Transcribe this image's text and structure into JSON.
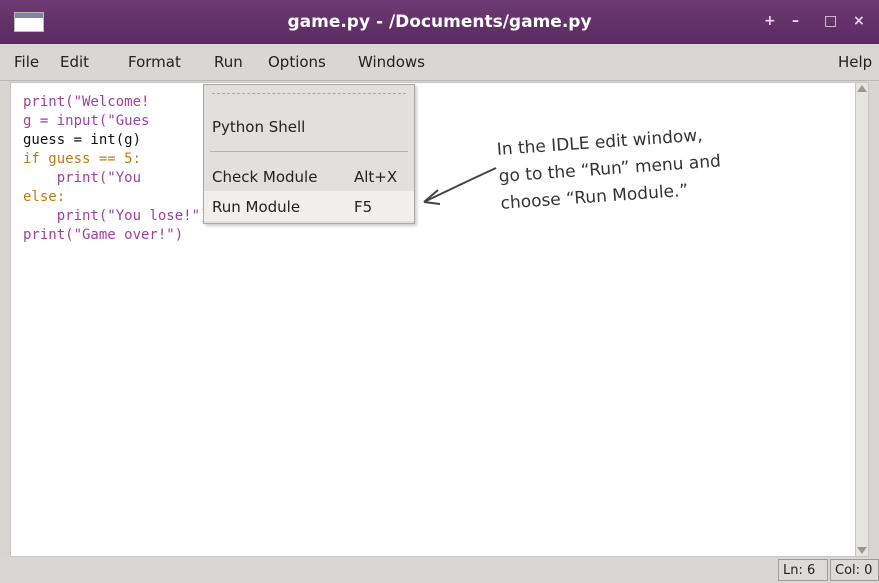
{
  "window": {
    "title": "game.py - /Documents/game.py",
    "controls": {
      "pin": "+",
      "minimize": "–",
      "maximize": "□",
      "close": "×"
    }
  },
  "menubar": {
    "items": [
      "File",
      "Edit",
      "Format",
      "Run",
      "Options",
      "Windows"
    ],
    "help": "Help"
  },
  "code_lines": [
    "print(\"Welcome!",
    "g = input(\"Gues",
    "guess = int(g)",
    "if guess == 5:",
    "    print(\"You",
    "else:",
    "    print(\"You lose!\")",
    "print(\"Game over!\")"
  ],
  "run_menu": {
    "items": [
      {
        "label": "Python Shell",
        "accel": ""
      },
      {
        "label": "Check Module",
        "accel": "Alt+X"
      },
      {
        "label": "Run Module",
        "accel": "F5"
      }
    ]
  },
  "annotation": {
    "lines": [
      "In the IDLE edit window,",
      "go to the “Run” menu and",
      "choose “Run Module.”"
    ]
  },
  "statusbar": {
    "line": "Ln: 6",
    "col": "Col: 0"
  },
  "colors": {
    "titlebar": "#5a2a60",
    "keyword": "#c07a10",
    "builtin": "#a040a0",
    "string": "#159a15"
  }
}
